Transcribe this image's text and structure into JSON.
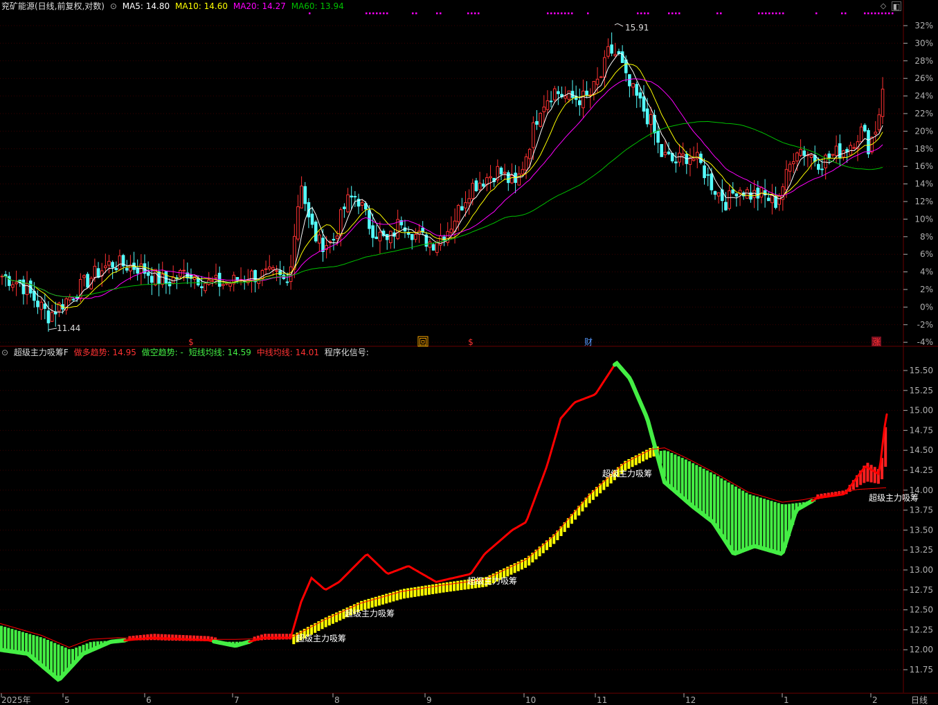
{
  "top_header": {
    "title": "兖矿能源(日线,前复权,对数)",
    "ma5_label": "MA5: 14.80",
    "ma10_label": "MA10: 14.60",
    "ma20_label": "MA20: 14.27",
    "ma60_label": "MA60: 13.94"
  },
  "bottom_header": {
    "title": "超级主力吸筹F",
    "long_label": "做多趋势: 14.95",
    "short_label": "做空趋势: -",
    "short_ma_label": "短线均线: 14.59",
    "mid_ma_label": "中线均线: 14.01",
    "signal_label": "程序化信号:"
  },
  "colors": {
    "up": "#ff3232",
    "down": "#54ffff",
    "ma5": "#ffffff",
    "ma10": "#ffff00",
    "ma20": "#ff00ff",
    "ma60": "#00c000",
    "long": "#ff0000",
    "short": "#44ee44",
    "yellow": "#ffff00",
    "green_bar": "#44ee44",
    "grid": "#3a0000",
    "axis": "#b0b0b0"
  },
  "chart_data": [
    {
      "type": "candlestick",
      "title": "兖矿能源(日线,前复权,对数)",
      "y_scale": "log-percent",
      "y_ticks": [
        "32%",
        "30%",
        "28%",
        "26%",
        "24%",
        "22%",
        "20%",
        "18%",
        "16%",
        "14%",
        "12%",
        "10%",
        "8%",
        "6%",
        "4%",
        "2%",
        "0%",
        "-2%",
        "-4%"
      ],
      "annotations": {
        "high_label": "15.91",
        "low_label": "11.44"
      },
      "event_markers": [
        "$",
        "回",
        "$",
        "财",
        "涨"
      ],
      "x_month_labels": [
        "2025年",
        "5",
        "6",
        "7",
        "8",
        "9",
        "10",
        "11",
        "12",
        "1",
        "2"
      ],
      "period_label": "日线"
    },
    {
      "type": "indicator",
      "title": "超级主力吸筹F",
      "y_ticks": [
        "15.50",
        "15.25",
        "15.00",
        "14.75",
        "14.50",
        "14.25",
        "14.00",
        "13.75",
        "13.50",
        "13.25",
        "13.00",
        "12.75",
        "12.50",
        "12.25",
        "12.00",
        "11.75"
      ],
      "signal_labels": [
        "超级主力吸筹",
        "超级主力吸筹",
        "超级主力吸筹",
        "超级主力吸筹",
        "超级主力吸筹"
      ]
    }
  ]
}
